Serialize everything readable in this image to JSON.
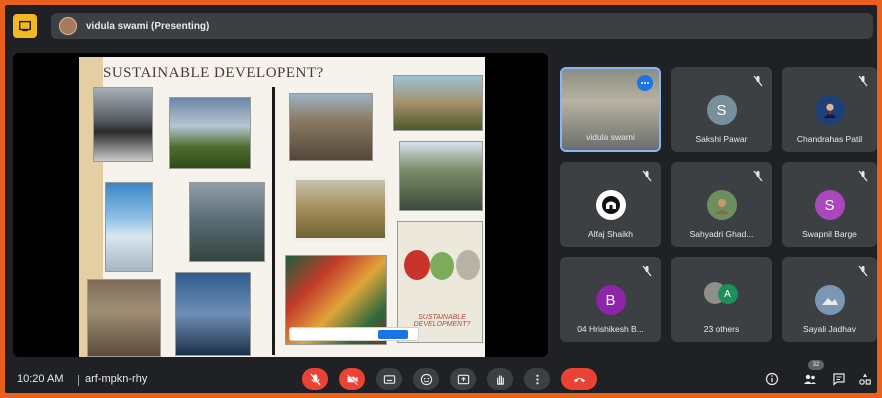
{
  "header": {
    "presenter_label": "vidula swami (Presenting)"
  },
  "slide": {
    "title": "SUSTAINABLE DEVELOPENT?",
    "poster_text": "SUSTAINABLE DEVELOPMENT?"
  },
  "tiles": [
    {
      "name": "vidula swami",
      "type": "video",
      "active": true
    },
    {
      "name": "Sakshi Pawar",
      "initial": "S",
      "color": "#78909c",
      "muted": true
    },
    {
      "name": "Chandrahas Patil",
      "type": "photo",
      "muted": true
    },
    {
      "name": "Alfaj Shaikh",
      "type": "logo",
      "muted": true
    },
    {
      "name": "Sahyadri Ghad...",
      "type": "photo",
      "muted": true
    },
    {
      "name": "Swapnil Barge",
      "initial": "S",
      "color": "#ab47bc",
      "muted": true
    },
    {
      "name": "04 Hrishikesh B...",
      "initial": "B",
      "color": "#8e24aa",
      "muted": true
    },
    {
      "name": "23 others",
      "type": "group",
      "group_initial": "A"
    },
    {
      "name": "Sayali Jadhav",
      "type": "photo",
      "muted": true
    }
  ],
  "footer": {
    "time": "10:20 AM",
    "meeting_code": "arf-mpkn-rhy",
    "participant_count": "32"
  },
  "colors": {
    "accent": "#1a73e8",
    "danger": "#ea4335",
    "border": "#e8601c",
    "surface": "#3c4043",
    "background": "#202124"
  }
}
